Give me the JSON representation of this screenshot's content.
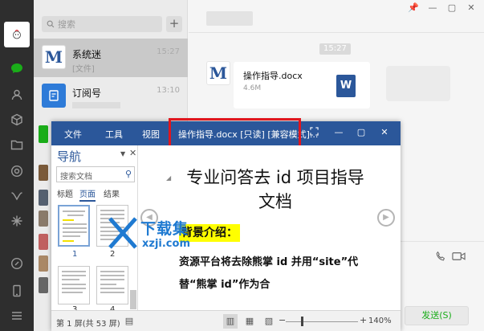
{
  "colors": {
    "word_blue": "#2b579a",
    "rail": "#2e2e2e",
    "wechat_green": "#1aad19",
    "highlight_red": "#e0161e"
  },
  "sidebar": {
    "icons": [
      "chat-icon",
      "contacts-icon",
      "favorites-icon",
      "files-icon",
      "moments-icon",
      "miniprogram-icon",
      "search-icon",
      "link-icon",
      "phone-icon",
      "menu-icon"
    ]
  },
  "chatlist": {
    "search_placeholder": "搜索",
    "add_label": "+",
    "items": [
      {
        "name": "系统迷",
        "subtitle": "[文件]",
        "time": "15:27"
      },
      {
        "name": "订阅号",
        "subtitle": "",
        "time": "13:10"
      }
    ]
  },
  "conversation": {
    "window_controls": [
      "📌",
      "—",
      "▢",
      "✕"
    ],
    "time_chip": "15:27",
    "file": {
      "name": "操作指导.docx",
      "size": "4.6M",
      "icon_letter": "W"
    },
    "send_label": "发送(S)"
  },
  "word": {
    "tabs": [
      "文件",
      "工具",
      "视图"
    ],
    "title": "操作指导.docx [只读] [兼容模式]...",
    "nav": {
      "title": "导航",
      "pin": "▼",
      "close": "✕",
      "search_placeholder": "搜索文档",
      "tabs": [
        "标题",
        "页面",
        "结果"
      ],
      "page_numbers": [
        "1",
        "2",
        "3",
        "4"
      ]
    },
    "content": {
      "heading": "专业问答去 id 项目指导文档",
      "section_label": "背景介绍：",
      "paragraph": "资源平台将去除熊掌 id 并用“site”代替“熊掌 id”作为合"
    },
    "status": {
      "page_info": "第 1 屏(共 53 屏)",
      "zoom": "140%"
    }
  },
  "watermark": {
    "line1": "下载集",
    "line2": "xzji.com"
  }
}
